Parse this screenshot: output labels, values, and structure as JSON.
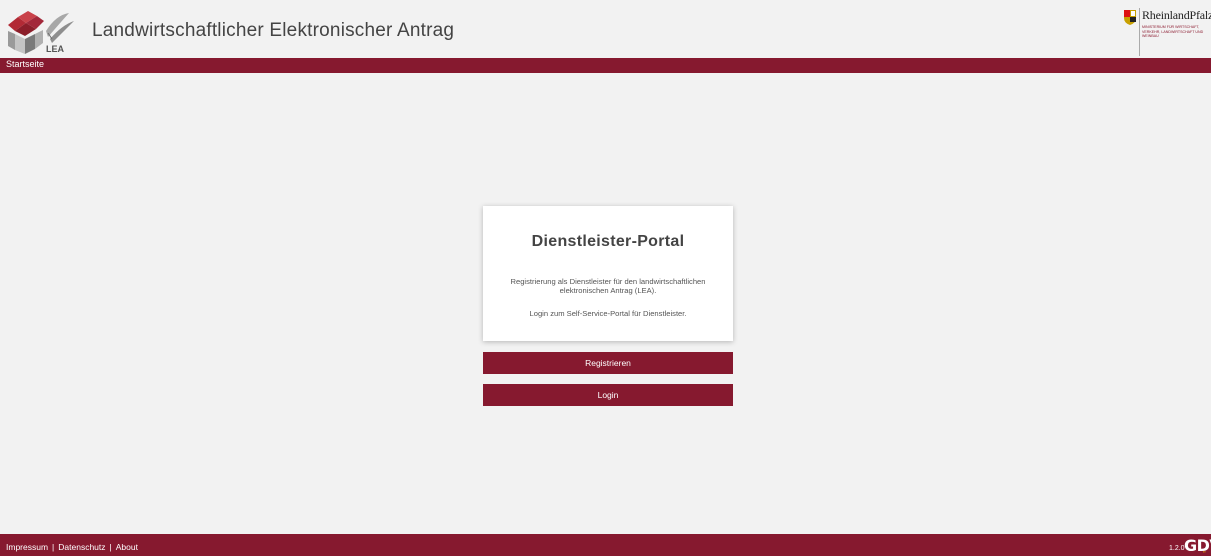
{
  "header": {
    "title": "Landwirtschaftlicher Elektronischer Antrag",
    "logo_text": "LEA",
    "ministry_logo_name": "RheinlandPfalz",
    "ministry_logo_subtext": "MINISTERIUM FÜR WIRTSCHAFT, VERKEHR, LANDWIRTSCHAFT UND WEINBAU",
    "icons": [
      "lea-logo",
      "rlp-crest"
    ]
  },
  "navbar": {
    "items": [
      {
        "label": "Startseite"
      }
    ]
  },
  "main": {
    "card_title": "Dienstleister-Portal",
    "card_text_1": "Registrierung als Dienstleister für den landwirtschaftlichen elektronischen Antrag (LEA).",
    "card_text_2": "Login zum Self-Service-Portal für Dienstleister.",
    "register_label": "Registrieren",
    "login_label": "Login"
  },
  "footer": {
    "links": [
      {
        "label": "Impressum"
      },
      {
        "label": "Datenschutz"
      },
      {
        "label": "About"
      }
    ],
    "version": "1.2.0",
    "gdv_logo": "GDV"
  },
  "colors": {
    "brand": "#86192f",
    "background": "#f2f2f2",
    "card": "#ffffff",
    "text": "#444444"
  }
}
